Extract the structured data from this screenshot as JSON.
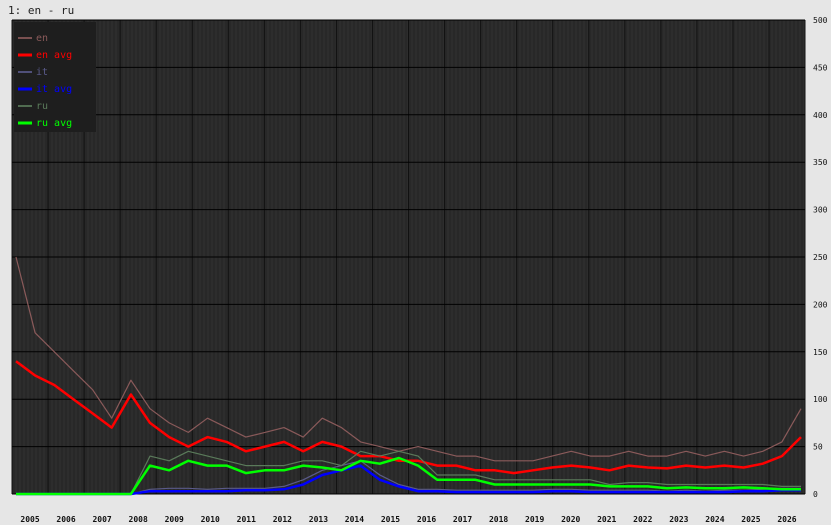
{
  "window_title": "1: en - ru",
  "colors": {
    "background": "#e6e6e6",
    "plot_bg": "#282828",
    "grid_major": "#000000",
    "en": "#8a5a5a",
    "en_avg": "#ff0000",
    "it": "#5a5a8a",
    "it_avg": "#0000ff",
    "ru": "#5a7a5a",
    "ru_avg": "#00ff00"
  },
  "chart_data": {
    "type": "line",
    "title": "1: en - ru",
    "xlabel": "",
    "ylabel": "",
    "ylim": [
      0,
      500
    ],
    "yticks": [
      0,
      50,
      100,
      150,
      200,
      250,
      300,
      350,
      400,
      450,
      500
    ],
    "year_labels": [
      "2005",
      "2006",
      "2007",
      "2008",
      "2009",
      "2010",
      "2011",
      "2012",
      "2013",
      "2014",
      "2015",
      "2016",
      "2017",
      "2018",
      "2019",
      "2020",
      "2021",
      "2022",
      "2023",
      "2024",
      "2025",
      "2026"
    ],
    "legend_position": "top-left",
    "grid": true,
    "x": [
      "2005-12",
      "2006-06",
      "2006-12",
      "2007-06",
      "2007-12",
      "2008-06",
      "2008-12",
      "2009-06",
      "2009-12",
      "2010-06",
      "2010-12",
      "2011-06",
      "2011-12",
      "2012-06",
      "2012-12",
      "2013-06",
      "2013-12",
      "2014-06",
      "2014-12",
      "2015-06",
      "2015-12",
      "2016-06",
      "2016-12",
      "2017-06",
      "2017-12",
      "2018-06",
      "2018-12",
      "2019-06",
      "2019-12",
      "2020-06",
      "2020-12",
      "2021-06",
      "2021-12",
      "2022-06",
      "2022-12",
      "2023-06",
      "2023-12",
      "2024-06",
      "2024-12",
      "2025-06",
      "2025-12",
      "2026-06"
    ],
    "series": [
      {
        "name": "en",
        "values": [
          250,
          170,
          150,
          130,
          110,
          80,
          120,
          90,
          75,
          65,
          80,
          70,
          60,
          65,
          70,
          60,
          80,
          70,
          55,
          50,
          45,
          50,
          45,
          40,
          40,
          35,
          35,
          35,
          40,
          45,
          40,
          40,
          45,
          40,
          40,
          45,
          40,
          45,
          40,
          45,
          55,
          90
        ]
      },
      {
        "name": "en avg",
        "values": [
          140,
          125,
          115,
          100,
          85,
          70,
          105,
          75,
          60,
          50,
          60,
          55,
          45,
          50,
          55,
          45,
          55,
          50,
          40,
          40,
          35,
          35,
          30,
          30,
          25,
          25,
          22,
          25,
          28,
          30,
          28,
          25,
          30,
          28,
          27,
          30,
          28,
          30,
          28,
          32,
          40,
          60
        ]
      },
      {
        "name": "it",
        "values": [
          0,
          0,
          0,
          0,
          0,
          0,
          0,
          5,
          6,
          6,
          5,
          6,
          6,
          6,
          8,
          15,
          25,
          30,
          35,
          20,
          10,
          5,
          5,
          4,
          4,
          4,
          4,
          4,
          5,
          5,
          4,
          4,
          4,
          4,
          3,
          4,
          3,
          4,
          4,
          5,
          6,
          6
        ]
      },
      {
        "name": "it avg",
        "values": [
          0,
          0,
          0,
          0,
          0,
          0,
          0,
          3,
          3,
          3,
          3,
          3,
          4,
          4,
          5,
          10,
          20,
          25,
          30,
          15,
          8,
          3,
          3,
          2,
          2,
          2,
          2,
          2,
          3,
          3,
          2,
          2,
          2,
          2,
          2,
          2,
          2,
          2,
          3,
          3,
          4,
          4
        ]
      },
      {
        "name": "ru",
        "values": [
          0,
          0,
          0,
          0,
          0,
          0,
          0,
          40,
          35,
          45,
          40,
          35,
          30,
          30,
          30,
          35,
          35,
          30,
          45,
          40,
          45,
          40,
          20,
          20,
          20,
          15,
          15,
          15,
          15,
          15,
          15,
          10,
          12,
          12,
          10,
          10,
          10,
          10,
          10,
          10,
          8,
          8
        ]
      },
      {
        "name": "ru avg",
        "values": [
          0,
          0,
          0,
          0,
          0,
          0,
          0,
          30,
          25,
          35,
          30,
          30,
          22,
          25,
          25,
          30,
          28,
          25,
          35,
          32,
          38,
          30,
          15,
          15,
          15,
          10,
          10,
          10,
          10,
          10,
          10,
          8,
          8,
          8,
          6,
          7,
          6,
          6,
          7,
          6,
          5,
          5
        ]
      }
    ]
  }
}
